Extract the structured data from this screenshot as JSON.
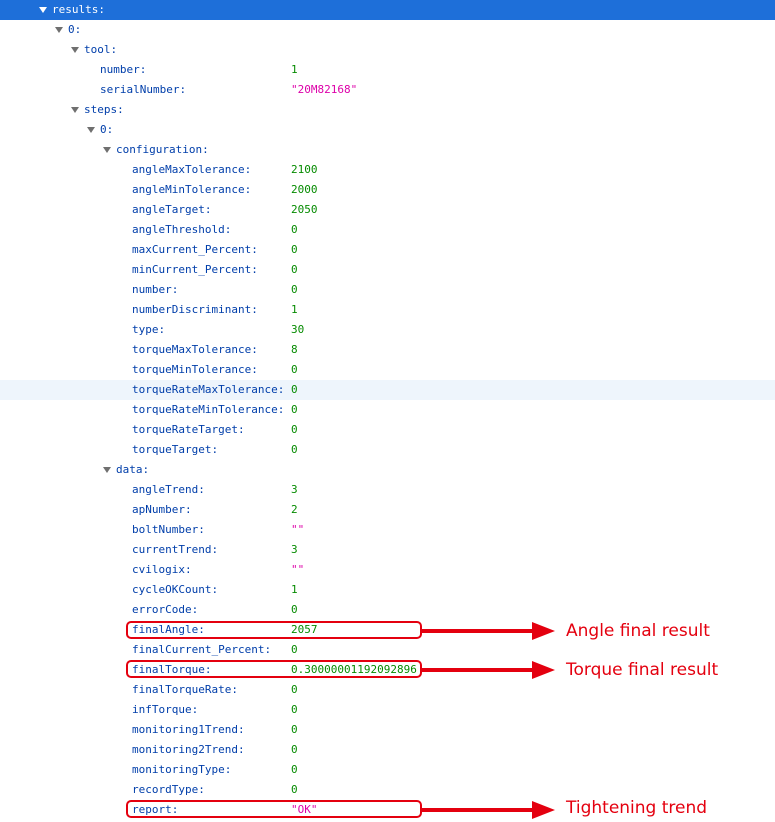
{
  "tree": {
    "results": "results:",
    "result_0": "0:",
    "tool": {
      "label": "tool:",
      "number": {
        "key": "number:",
        "value": "1"
      },
      "serialNumber": {
        "key": "serialNumber:",
        "value": "\"20M82168\""
      }
    },
    "steps": {
      "label": "steps:",
      "step_0": "0:",
      "configuration": {
        "label": "configuration:",
        "angleMaxTolerance": {
          "key": "angleMaxTolerance:",
          "value": "2100"
        },
        "angleMinTolerance": {
          "key": "angleMinTolerance:",
          "value": "2000"
        },
        "angleTarget": {
          "key": "angleTarget:",
          "value": "2050"
        },
        "angleThreshold": {
          "key": "angleThreshold:",
          "value": "0"
        },
        "maxCurrent_Percent": {
          "key": "maxCurrent_Percent:",
          "value": "0"
        },
        "minCurrent_Percent": {
          "key": "minCurrent_Percent:",
          "value": "0"
        },
        "number": {
          "key": "number:",
          "value": "0"
        },
        "numberDiscriminant": {
          "key": "numberDiscriminant:",
          "value": "1"
        },
        "type": {
          "key": "type:",
          "value": "30"
        },
        "torqueMaxTolerance": {
          "key": "torqueMaxTolerance:",
          "value": "8"
        },
        "torqueMinTolerance": {
          "key": "torqueMinTolerance:",
          "value": "0"
        },
        "torqueRateMaxTolerance": {
          "key": "torqueRateMaxTolerance:",
          "value": "0"
        },
        "torqueRateMinTolerance": {
          "key": "torqueRateMinTolerance:",
          "value": "0"
        },
        "torqueRateTarget": {
          "key": "torqueRateTarget:",
          "value": "0"
        },
        "torqueTarget": {
          "key": "torqueTarget:",
          "value": "0"
        }
      },
      "data": {
        "label": "data:",
        "angleTrend": {
          "key": "angleTrend:",
          "value": "3"
        },
        "apNumber": {
          "key": "apNumber:",
          "value": "2"
        },
        "boltNumber": {
          "key": "boltNumber:",
          "value": "\"\""
        },
        "currentTrend": {
          "key": "currentTrend:",
          "value": "3"
        },
        "cvilogix": {
          "key": "cvilogix:",
          "value": "\"\""
        },
        "cycleOKCount": {
          "key": "cycleOKCount:",
          "value": "1"
        },
        "errorCode": {
          "key": "errorCode:",
          "value": "0"
        },
        "finalAngle": {
          "key": "finalAngle:",
          "value": "2057"
        },
        "finalCurrent_Percent": {
          "key": "finalCurrent_Percent:",
          "value": "0"
        },
        "finalTorque": {
          "key": "finalTorque:",
          "value": "0.30000001192092896"
        },
        "finalTorqueRate": {
          "key": "finalTorqueRate:",
          "value": "0"
        },
        "infTorque": {
          "key": "infTorque:",
          "value": "0"
        },
        "monitoring1Trend": {
          "key": "monitoring1Trend:",
          "value": "0"
        },
        "monitoring2Trend": {
          "key": "monitoring2Trend:",
          "value": "0"
        },
        "monitoringType": {
          "key": "monitoringType:",
          "value": "0"
        },
        "recordType": {
          "key": "recordType:",
          "value": "0"
        },
        "report": {
          "key": "report:",
          "value": "\"OK\""
        }
      }
    }
  },
  "annotations": {
    "angle": "Angle final result",
    "torque": "Torque final result",
    "trend": "Tightening trend"
  },
  "colors": {
    "key": "#003eaa",
    "number": "#058b00",
    "string": "#dd00a9",
    "selected_row": "#1e6fd9",
    "annotation": "#e4000f"
  }
}
